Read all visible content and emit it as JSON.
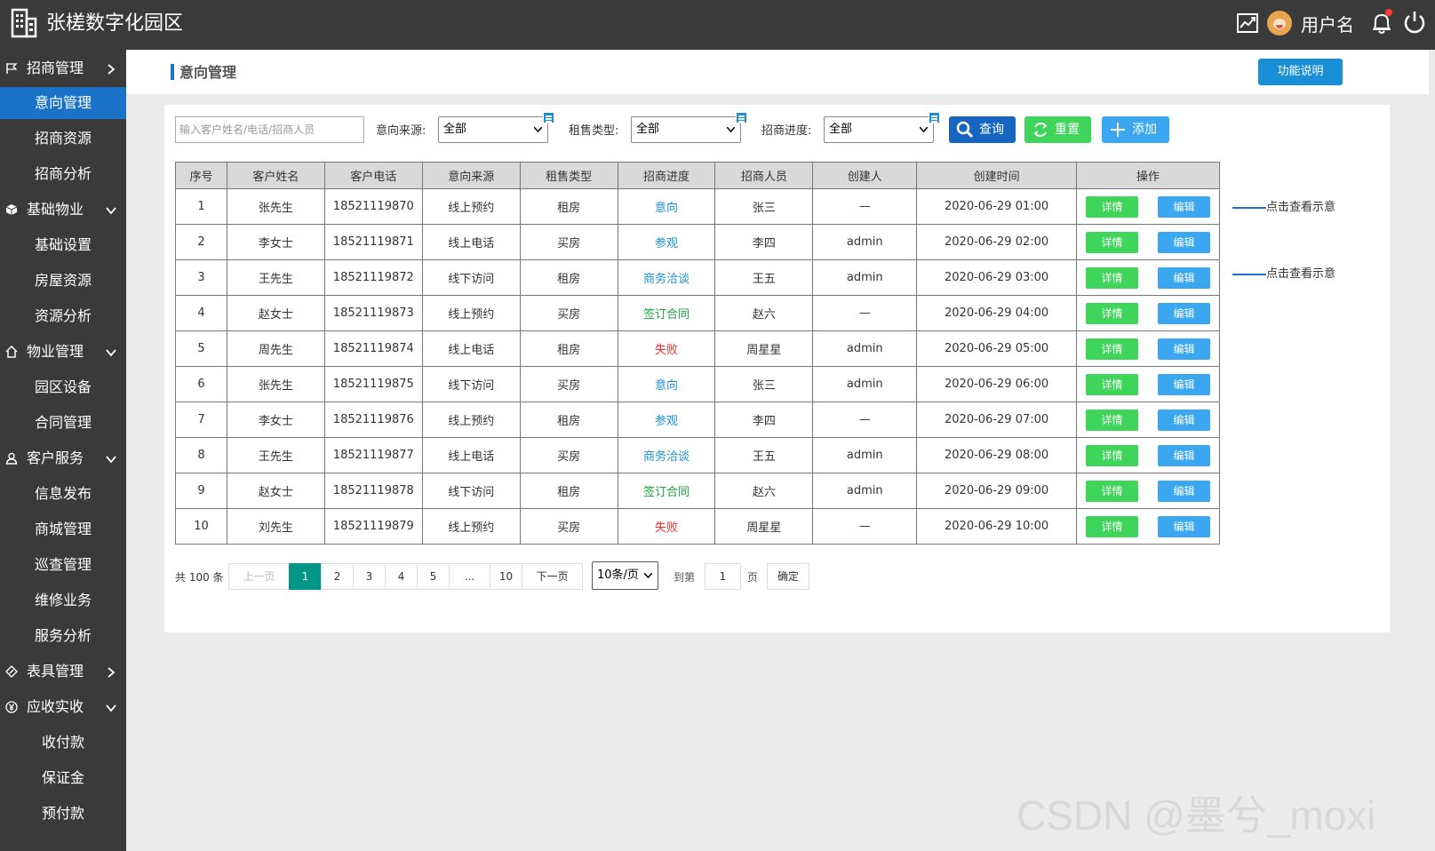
{
  "app": {
    "title": "张槎数字化园区",
    "username": "用户名"
  },
  "sidebar": {
    "groups": [
      {
        "label": "招商管理",
        "icon": "flag-icon",
        "expanded": false
      },
      {
        "label": "基础物业",
        "icon": "cube-icon",
        "expanded": true
      },
      {
        "label": "物业管理",
        "icon": "home-icon",
        "expanded": true
      },
      {
        "label": "客户服务",
        "icon": "user-icon",
        "expanded": true
      },
      {
        "label": "表具管理",
        "icon": "gauge-icon",
        "expanded": false
      },
      {
        "label": "应收实收",
        "icon": "yen-icon",
        "expanded": true
      }
    ],
    "items": [
      "意向管理",
      "招商资源",
      "招商分析",
      "基础设置",
      "房屋资源",
      "资源分析",
      "园区设备",
      "合同管理",
      "信息发布",
      "商城管理",
      "巡查管理",
      "维修业务",
      "服务分析",
      "收付款",
      "保证金",
      "预付款"
    ],
    "active": "意向管理"
  },
  "header": {
    "title": "意向管理",
    "func_button": "功能说明"
  },
  "filters": {
    "search_placeholder": "输入客户姓名/电话/招商人员",
    "source_label": "意向来源:",
    "source_value": "全部",
    "type_label": "租售类型:",
    "type_value": "全部",
    "progress_label": "招商进度:",
    "progress_value": "全部",
    "query_button": "查询",
    "reset_button": "重置",
    "add_button": "添加"
  },
  "table": {
    "columns": [
      "序号",
      "客户姓名",
      "客户电话",
      "意向来源",
      "租售类型",
      "招商进度",
      "招商人员",
      "创建人",
      "创建时间",
      "操作"
    ],
    "rows": [
      [
        "1",
        "张先生",
        "18521119870",
        "线上预约",
        "租房",
        "意向",
        "张三",
        "—",
        "2020-06-29  01:00"
      ],
      [
        "2",
        "李女士",
        "18521119871",
        "线上电话",
        "买房",
        "参观",
        "李四",
        "admin",
        "2020-06-29  02:00"
      ],
      [
        "3",
        "王先生",
        "18521119872",
        "线下访问",
        "租房",
        "商务洽谈",
        "王五",
        "admin",
        "2020-06-29  03:00"
      ],
      [
        "4",
        "赵女士",
        "18521119873",
        "线上预约",
        "买房",
        "签订合同",
        "赵六",
        "—",
        "2020-06-29  04:00"
      ],
      [
        "5",
        "周先生",
        "18521119874",
        "线上电话",
        "租房",
        "失败",
        "周星星",
        "admin",
        "2020-06-29  05:00"
      ],
      [
        "6",
        "张先生",
        "18521119875",
        "线下访问",
        "买房",
        "意向",
        "张三",
        "admin",
        "2020-06-29  06:00"
      ],
      [
        "7",
        "李女士",
        "18521119876",
        "线上预约",
        "租房",
        "参观",
        "李四",
        "—",
        "2020-06-29  07:00"
      ],
      [
        "8",
        "王先生",
        "18521119877",
        "线上电话",
        "买房",
        "商务洽谈",
        "王五",
        "admin",
        "2020-06-29  08:00"
      ],
      [
        "9",
        "赵女士",
        "18521119878",
        "线下访问",
        "租房",
        "签订合同",
        "赵六",
        "admin",
        "2020-06-29  09:00"
      ],
      [
        "10",
        "刘先生",
        "18521119879",
        "线上预约",
        "买房",
        "失败",
        "周星星",
        "—",
        "2020-06-29  10:00"
      ]
    ],
    "detail_button": "详情",
    "edit_button": "编辑",
    "progress_colors": {
      "意向": "#1a8fd8",
      "参观": "#1a8fd8",
      "商务洽谈": "#1a8fd8",
      "签订合同": "#1aa33a",
      "失败": "#ff2b2b"
    }
  },
  "notes": [
    "点击查看示意",
    "点击查看示意"
  ],
  "pagination": {
    "total": "共 100 条",
    "prev": "上一页",
    "pages": [
      "1",
      "2",
      "3",
      "4",
      "5",
      "...",
      "10"
    ],
    "current": "1",
    "next": "下一页",
    "page_size": "10条/页",
    "goto_label": "到第",
    "goto_value": "1",
    "page_unit": "页",
    "confirm": "确定"
  },
  "watermark": "CSDN @墨兮_moxi"
}
